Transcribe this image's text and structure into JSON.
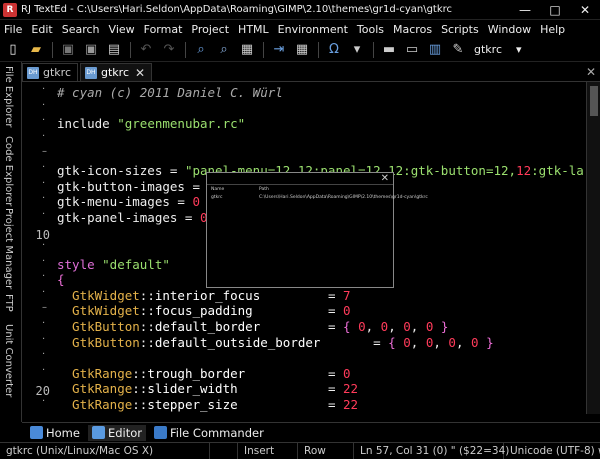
{
  "window": {
    "title": "RJ TextEd - C:\\Users\\Hari.Seldon\\AppData\\Roaming\\GIMP\\2.10\\themes\\gr1d-cyan\\gtkrc",
    "controls": [
      "—",
      "□",
      "✕"
    ]
  },
  "menu": [
    "File",
    "Edit",
    "Search",
    "View",
    "Format",
    "Project",
    "HTML",
    "Environment",
    "Tools",
    "Macros",
    "Scripts",
    "Window",
    "Help"
  ],
  "toolbar": {
    "buttons": [
      {
        "name": "new-file-icon",
        "glyph": "▯",
        "color": "#eeeeee"
      },
      {
        "name": "open-folder-icon",
        "glyph": "▰",
        "color": "#e8b84a"
      },
      {
        "name": "save-icon",
        "glyph": "▣",
        "color": "#777777"
      },
      {
        "name": "save-all-icon",
        "glyph": "▣",
        "color": "#999999"
      },
      {
        "name": "print-icon",
        "glyph": "▤",
        "color": "#cccccc"
      },
      {
        "name": "undo-icon",
        "glyph": "↶",
        "color": "#555555"
      },
      {
        "name": "redo-icon",
        "glyph": "↷",
        "color": "#555555"
      },
      {
        "name": "search-icon",
        "glyph": "⌕",
        "color": "#6aa0e0"
      },
      {
        "name": "replace-icon",
        "glyph": "⌕",
        "color": "#8ab0e0"
      },
      {
        "name": "find-files-icon",
        "glyph": "▦",
        "color": "#cccccc"
      },
      {
        "name": "goto-icon",
        "glyph": "⇥",
        "color": "#6aa0e0"
      },
      {
        "name": "bookmark-icon",
        "glyph": "▦",
        "color": "#cccccc"
      },
      {
        "name": "omega-icon",
        "glyph": "Ω",
        "color": "#6aa0e0"
      },
      {
        "name": "tools-icon",
        "glyph": "▾",
        "color": "#cccccc"
      },
      {
        "name": "layout-icon",
        "glyph": "▬",
        "color": "#cccccc"
      },
      {
        "name": "window-icon",
        "glyph": "▭",
        "color": "#cccccc"
      },
      {
        "name": "panel-icon",
        "glyph": "▥",
        "color": "#6aa0e0"
      },
      {
        "name": "brush-icon",
        "glyph": "✎",
        "color": "#cccccc"
      }
    ],
    "label": "gtkrc",
    "dropdown": "▾"
  },
  "sidebar": [
    "File Explorer",
    "Code Explorer",
    "Project Manager",
    "FTP",
    "Unit Converter"
  ],
  "tabs": [
    {
      "label": "gtkrc",
      "active": false
    },
    {
      "label": "gtkrc",
      "active": true,
      "close": "✕"
    }
  ],
  "tab_close": "✕",
  "gutter": {
    "line10": "10",
    "line20": "20"
  },
  "code": [
    [
      {
        "t": "# cyan (c) 2011 Daniel C. Würl",
        "c": "c-comment"
      }
    ],
    [],
    [
      {
        "t": "include ",
        "c": "c-plain"
      },
      {
        "t": "\"greenmenubar.rc\"",
        "c": "c-str"
      }
    ],
    [],
    [],
    [
      {
        "t": "gtk-icon-sizes = ",
        "c": "c-plain"
      },
      {
        "t": "\"panel-menu=12,12:panel=12,12:gtk-button=12,",
        "c": "c-str"
      },
      {
        "t": "12",
        "c": "c-num"
      },
      {
        "t": ":gtk-large-t",
        "c": "c-str"
      }
    ],
    [
      {
        "t": "gtk-button-images = ",
        "c": "c-plain"
      },
      {
        "t": "0",
        "c": "c-num"
      }
    ],
    [
      {
        "t": "gtk-menu-images = ",
        "c": "c-plain"
      },
      {
        "t": "0",
        "c": "c-num"
      }
    ],
    [
      {
        "t": "gtk-panel-images = ",
        "c": "c-plain"
      },
      {
        "t": "0",
        "c": "c-num"
      }
    ],
    [],
    [],
    [
      {
        "t": "style ",
        "c": "c-kw"
      },
      {
        "t": "\"default\"",
        "c": "c-str"
      }
    ],
    [
      {
        "t": "{",
        "c": "c-sym"
      }
    ],
    [
      {
        "t": "  GtkWidget",
        "c": "c-prop"
      },
      {
        "t": "::",
        "c": "c-plain"
      },
      {
        "t": "interior_focus",
        "c": "c-def"
      },
      {
        "t": "         = ",
        "c": "c-plain"
      },
      {
        "t": "7",
        "c": "c-num"
      }
    ],
    [
      {
        "t": "  GtkWidget",
        "c": "c-prop"
      },
      {
        "t": "::",
        "c": "c-plain"
      },
      {
        "t": "focus_padding",
        "c": "c-def"
      },
      {
        "t": "          = ",
        "c": "c-plain"
      },
      {
        "t": "0",
        "c": "c-num"
      }
    ],
    [
      {
        "t": "  GtkButton",
        "c": "c-prop"
      },
      {
        "t": "::",
        "c": "c-plain"
      },
      {
        "t": "default_border",
        "c": "c-def"
      },
      {
        "t": "         = ",
        "c": "c-plain"
      },
      {
        "t": "{ ",
        "c": "c-sym"
      },
      {
        "t": "0",
        "c": "c-num"
      },
      {
        "t": ", ",
        "c": "c-plain"
      },
      {
        "t": "0",
        "c": "c-num"
      },
      {
        "t": ", ",
        "c": "c-plain"
      },
      {
        "t": "0",
        "c": "c-num"
      },
      {
        "t": ", ",
        "c": "c-plain"
      },
      {
        "t": "0",
        "c": "c-num"
      },
      {
        "t": " }",
        "c": "c-sym"
      }
    ],
    [
      {
        "t": "  GtkButton",
        "c": "c-prop"
      },
      {
        "t": "::",
        "c": "c-plain"
      },
      {
        "t": "default_outside_border",
        "c": "c-def"
      },
      {
        "t": "       = ",
        "c": "c-plain"
      },
      {
        "t": "{ ",
        "c": "c-sym"
      },
      {
        "t": "0",
        "c": "c-num"
      },
      {
        "t": ", ",
        "c": "c-plain"
      },
      {
        "t": "0",
        "c": "c-num"
      },
      {
        "t": ", ",
        "c": "c-plain"
      },
      {
        "t": "0",
        "c": "c-num"
      },
      {
        "t": ", ",
        "c": "c-plain"
      },
      {
        "t": "0",
        "c": "c-num"
      },
      {
        "t": " }",
        "c": "c-sym"
      }
    ],
    [],
    [
      {
        "t": "  GtkRange",
        "c": "c-prop"
      },
      {
        "t": "::",
        "c": "c-plain"
      },
      {
        "t": "trough_border",
        "c": "c-def"
      },
      {
        "t": "           = ",
        "c": "c-plain"
      },
      {
        "t": "0",
        "c": "c-num"
      }
    ],
    [
      {
        "t": "  GtkRange",
        "c": "c-prop"
      },
      {
        "t": "::",
        "c": "c-plain"
      },
      {
        "t": "slider_width",
        "c": "c-def"
      },
      {
        "t": "            = ",
        "c": "c-plain"
      },
      {
        "t": "22",
        "c": "c-num"
      }
    ],
    [
      {
        "t": "  GtkRange",
        "c": "c-prop"
      },
      {
        "t": "::",
        "c": "c-plain"
      },
      {
        "t": "stepper_size",
        "c": "c-def"
      },
      {
        "t": "            = ",
        "c": "c-plain"
      },
      {
        "t": "22",
        "c": "c-num"
      }
    ]
  ],
  "popup": {
    "close": "✕",
    "col_name": "Name",
    "col_path": "Path",
    "row_name": "gtkrc",
    "row_path": "C:\\Users\\Hari.Seldon\\AppData\\Roaming\\GIMP\\2.10\\themes\\gr1d-cyan\\gtkrc"
  },
  "bottom_tabs": [
    {
      "label": "Home",
      "icon_color": "#4a8ad8",
      "active": false
    },
    {
      "label": "Editor",
      "icon_color": "#5a9ae0",
      "active": true
    },
    {
      "label": "File Commander",
      "icon_color": "#3a7ac8",
      "active": false
    }
  ],
  "status": [
    "gtkrc (Unix/Linux/Mac OS X)",
    "",
    "Insert",
    "Row",
    "Ln 57, Col 31 (0) \" ($22=34)",
    "Unicode (UTF-8) wit"
  ]
}
